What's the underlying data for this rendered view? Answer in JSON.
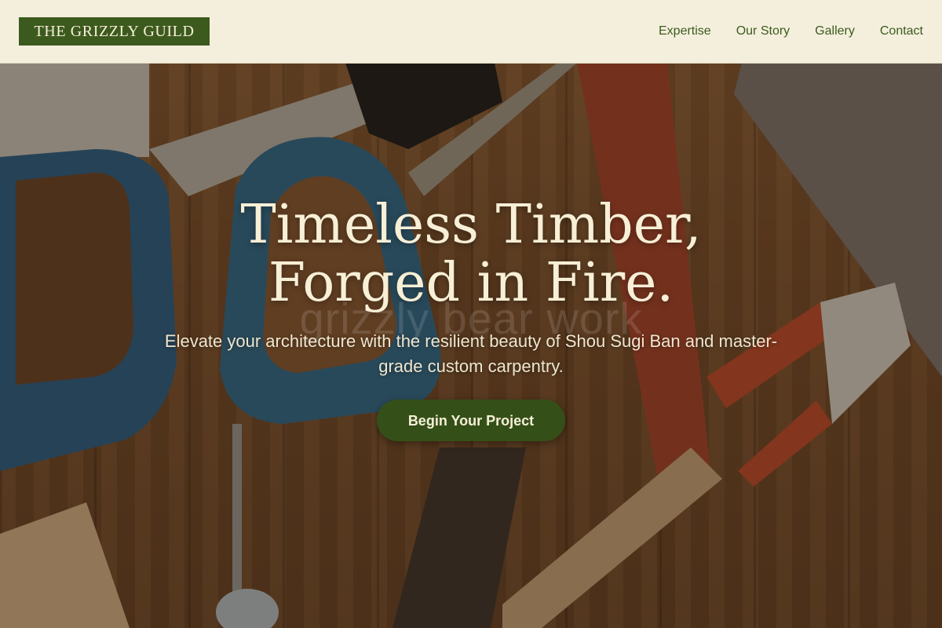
{
  "header": {
    "logo_text": "THE GRIZZLY GUILD",
    "nav": [
      {
        "label": "Expertise"
      },
      {
        "label": "Our Story"
      },
      {
        "label": "Gallery"
      },
      {
        "label": "Contact"
      }
    ]
  },
  "hero": {
    "headline_line1": "Timeless Timber,",
    "headline_line2": "Forged in Fire.",
    "ghost_text": "grizzly bear work",
    "subtext": "Elevate your architecture with the resilient beauty of Shou Sugi Ban and master-grade custom carpentry.",
    "cta_label": "Begin Your Project",
    "background_image": "tools-on-wood-workbench"
  },
  "colors": {
    "brand_green": "#3d5a1e",
    "button_green": "#345018",
    "header_bg": "#f4efdd",
    "cream_text": "#f7efd6"
  }
}
